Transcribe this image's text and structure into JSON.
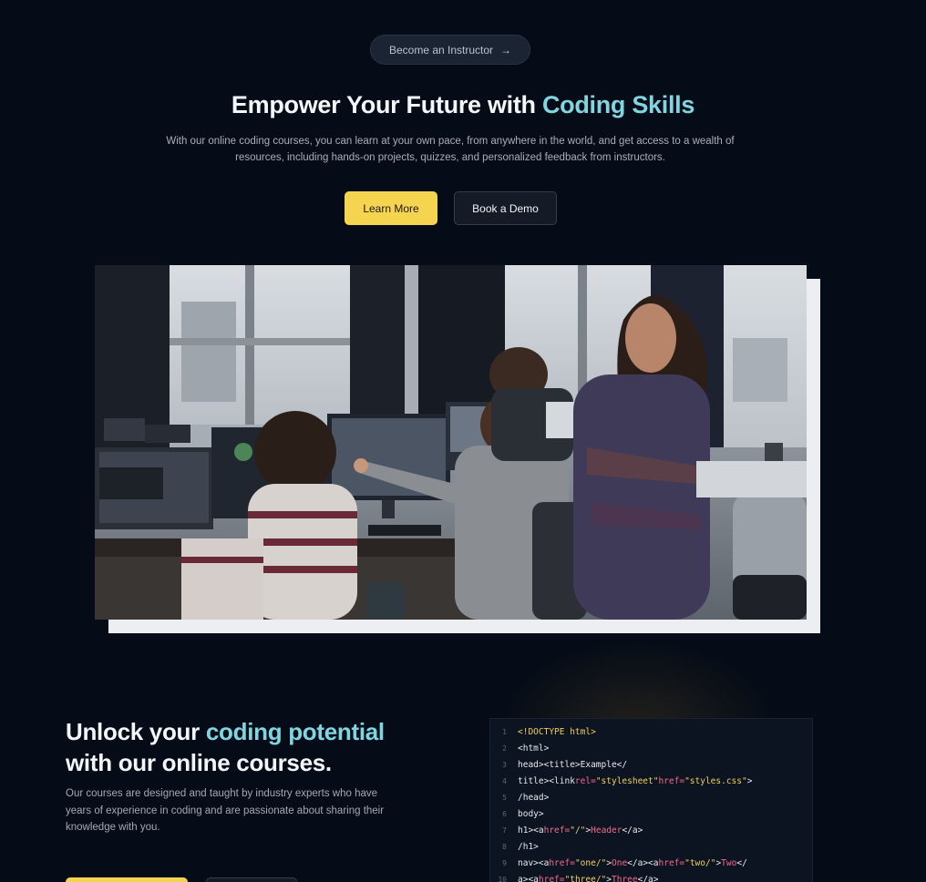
{
  "hero": {
    "pill_label": "Become an Instructor",
    "pill_arrow": "→",
    "title_main": "Empower Your Future with ",
    "title_accent": "Coding Skills",
    "description": "With our online coding courses, you can learn at your own pace, from anywhere in the world, and get access to a wealth of resources, including hands-on projects, quizzes, and personalized feedback from instructors.",
    "primary_button": "Learn More",
    "secondary_button": "Book a Demo"
  },
  "section": {
    "title_pre": "Unlock your ",
    "title_accent": "coding potential",
    "title_post": "with our online courses.",
    "description": "Our courses are designed and taught by industry experts who have years of experience in coding and are passionate about sharing their knowledge with you."
  },
  "code": {
    "lines": [
      {
        "n": "1",
        "parts": [
          [
            "y",
            "<!DOCTYPE html>"
          ]
        ]
      },
      {
        "n": "2",
        "parts": [
          [
            "w",
            "<html>"
          ]
        ]
      },
      {
        "n": "3",
        "parts": [
          [
            "w",
            "head><title>Example</"
          ]
        ]
      },
      {
        "n": "4",
        "parts": [
          [
            "w",
            "title><link"
          ],
          [
            "p",
            "rel="
          ],
          [
            "y",
            "\"stylesheet\""
          ],
          [
            "p",
            "href="
          ],
          [
            "y",
            "\"styles.css\""
          ],
          [
            "w",
            ">"
          ]
        ]
      },
      {
        "n": "5",
        "parts": [
          [
            "w",
            "/head>"
          ]
        ]
      },
      {
        "n": "6",
        "parts": [
          [
            "w",
            "body>"
          ]
        ]
      },
      {
        "n": "7",
        "parts": [
          [
            "w",
            "h1><a"
          ],
          [
            "p",
            "href="
          ],
          [
            "y",
            "\"/\""
          ],
          [
            "w",
            ">"
          ],
          [
            "p",
            "Header"
          ],
          [
            "w",
            "</a>"
          ]
        ]
      },
      {
        "n": "8",
        "parts": [
          [
            "w",
            "/h1>"
          ]
        ]
      },
      {
        "n": "9",
        "parts": [
          [
            "w",
            "nav><a"
          ],
          [
            "p",
            "href="
          ],
          [
            "y",
            "\"one/\""
          ],
          [
            "w",
            ">"
          ],
          [
            "p",
            "One"
          ],
          [
            "w",
            "</a><a"
          ],
          [
            "p",
            "href="
          ],
          [
            "y",
            "\"two/\""
          ],
          [
            "w",
            ">"
          ],
          [
            "p",
            "Two"
          ],
          [
            "w",
            "</"
          ]
        ]
      },
      {
        "n": "10",
        "parts": [
          [
            "w",
            "a><a"
          ],
          [
            "p",
            "href="
          ],
          [
            "y",
            "\"three/\""
          ],
          [
            "w",
            ">"
          ],
          [
            "p",
            "Three"
          ],
          [
            "w",
            "</a>"
          ]
        ]
      }
    ]
  },
  "colors": {
    "background": "#050c17",
    "accent_cyan": "#7fd6e0",
    "accent_yellow": "#f5d44f"
  },
  "icons": {
    "pill_arrow": "arrow-right-icon"
  }
}
